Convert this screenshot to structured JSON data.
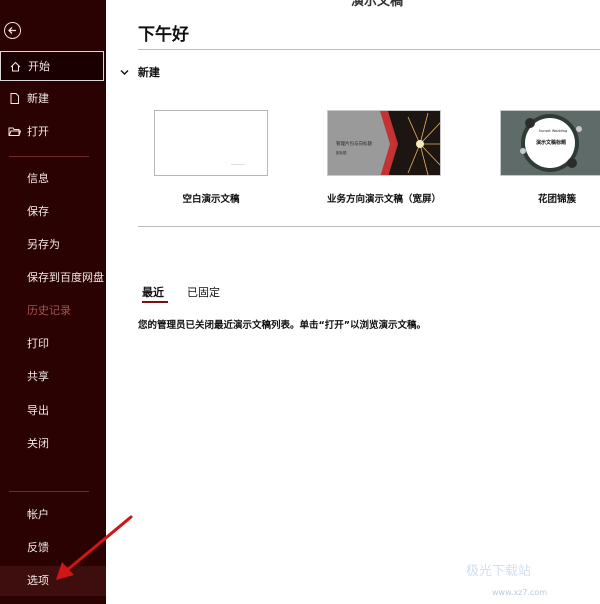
{
  "window": {
    "title": "演示文稿"
  },
  "sidebar": {
    "items": [
      {
        "label": "开始",
        "icon": "home-icon"
      },
      {
        "label": "新建",
        "icon": "new-file-icon"
      },
      {
        "label": "打开",
        "icon": "folder-open-icon"
      },
      {
        "label": "信息"
      },
      {
        "label": "保存"
      },
      {
        "label": "另存为"
      },
      {
        "label": "保存到百度网盘"
      },
      {
        "label": "历史记录"
      },
      {
        "label": "打印"
      },
      {
        "label": "共享"
      },
      {
        "label": "导出"
      },
      {
        "label": "关闭"
      },
      {
        "label": "帐户"
      },
      {
        "label": "反馈"
      },
      {
        "label": "选项"
      }
    ]
  },
  "main": {
    "greeting": "下午好",
    "new_section": "新建",
    "templates": [
      {
        "label": "空白演示文稿"
      },
      {
        "label": "业务方向演示文稿（宽屏）",
        "thumb_title": "管理片包与向标题",
        "thumb_sub": "副标题"
      },
      {
        "label": "花团锦簇",
        "thumb_title": "Sunset Wedding",
        "thumb_main": "演示文稿标题"
      }
    ],
    "tabs": [
      {
        "label": "最近"
      },
      {
        "label": "已固定"
      }
    ],
    "info": "您的管理员已关闭最近演示文稿列表。单击“打开”以浏览演示文稿。"
  },
  "watermark": {
    "text": "极光下载站",
    "sub": "www.xz7.com"
  },
  "colors": {
    "sidebar_bg": "#2a0202",
    "accent": "#7a1010",
    "annotation_arrow": "#d11414"
  }
}
